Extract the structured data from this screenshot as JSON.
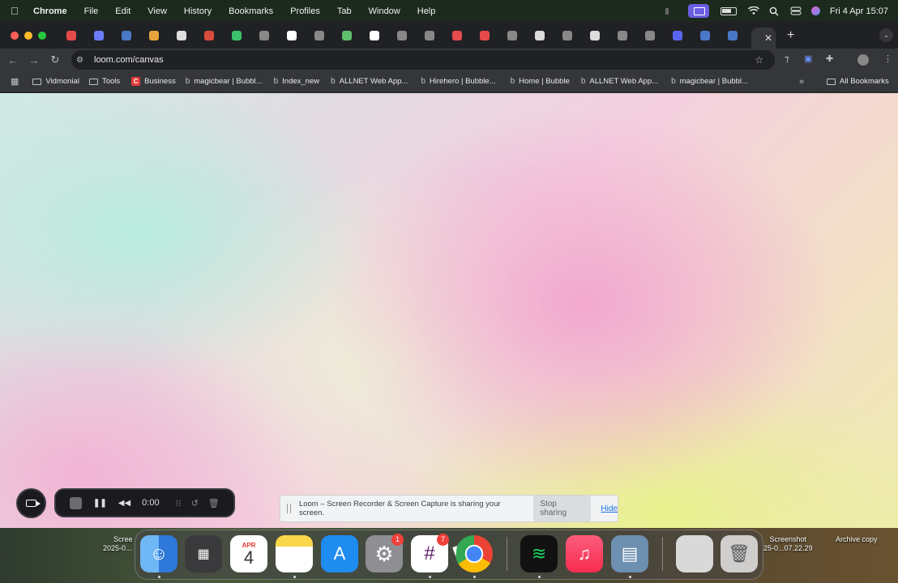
{
  "menubar": {
    "app_name": "Chrome",
    "items": [
      "File",
      "Edit",
      "View",
      "History",
      "Bookmarks",
      "Profiles",
      "Tab",
      "Window",
      "Help"
    ],
    "clock": "Fri 4 Apr  15:07"
  },
  "tabs": {
    "mini_tabs": [
      {
        "icon": "record-icon",
        "color": "#e64b4b"
      },
      {
        "icon": "gear-icon",
        "color": "#6b7cff"
      },
      {
        "icon": "bc-icon",
        "color": "#4a78c9"
      },
      {
        "icon": "grid-icon",
        "color": "#e8a33c"
      },
      {
        "icon": "x-icon",
        "color": "#dddddd"
      },
      {
        "icon": "gmail-icon",
        "color": "#d84c3e"
      },
      {
        "icon": "whatsapp-icon",
        "color": "#3ac16a"
      },
      {
        "icon": "circle-icon",
        "color": "#888888"
      },
      {
        "icon": "ai-icon",
        "color": "#ffffff"
      },
      {
        "icon": "tab-icon",
        "color": "#888888"
      },
      {
        "icon": "tab-icon",
        "color": "#5fbf6f"
      },
      {
        "icon": "w-icon",
        "color": "#ffffff"
      },
      {
        "icon": "bubble-icon",
        "color": "#888888"
      },
      {
        "icon": "bubble-icon",
        "color": "#888888"
      },
      {
        "icon": "slash-icon",
        "color": "#e64b4b"
      },
      {
        "icon": "slash-icon",
        "color": "#e64b4b"
      },
      {
        "icon": "tab-icon",
        "color": "#888888"
      },
      {
        "icon": "openai-icon",
        "color": "#dddddd"
      },
      {
        "icon": "tab-icon",
        "color": "#888888"
      },
      {
        "icon": "openai-icon",
        "color": "#dddddd"
      },
      {
        "icon": "tab-icon",
        "color": "#888888"
      },
      {
        "icon": "tab-icon",
        "color": "#888888"
      },
      {
        "icon": "s-icon",
        "color": "#5865f2"
      },
      {
        "icon": "w-icon",
        "color": "#4a78c9"
      },
      {
        "icon": "w-icon",
        "color": "#4a78c9"
      }
    ]
  },
  "toolbar": {
    "url": "loom.com/canvas"
  },
  "bookmarks": {
    "items": [
      {
        "label": "Vidmonial",
        "type": "folder"
      },
      {
        "label": "Tools",
        "type": "folder"
      },
      {
        "label": "Business",
        "type": "canva"
      },
      {
        "label": "magicbear | Bubbl...",
        "type": "bubble"
      },
      {
        "label": "Index_new",
        "type": "bubble"
      },
      {
        "label": "ALLNET Web App...",
        "type": "bubble"
      },
      {
        "label": "Hirehero | Bubble...",
        "type": "bubble"
      },
      {
        "label": "Home | Bubble",
        "type": "bubble"
      },
      {
        "label": "ALLNET Web App...",
        "type": "bubble"
      },
      {
        "label": "magicbear | Bubbl...",
        "type": "bubble"
      }
    ],
    "all_bookmarks": "All Bookmarks"
  },
  "loom": {
    "timer": "0:00"
  },
  "sharing": {
    "message": "Loom – Screen Recorder & Screen Capture is sharing your screen.",
    "stop_label": "Stop sharing",
    "hide_label": "Hide"
  },
  "desktop": {
    "left_label_1": "Scree",
    "left_label_2": "2025-0...",
    "screenshot_label_1": "Screenshot",
    "screenshot_label_2": "25-0...07.22.29",
    "archive_label": "Archive copy"
  },
  "dock": {
    "calendar_month": "APR",
    "calendar_day": "4",
    "settings_badge": "1",
    "slack_badge": "7"
  }
}
